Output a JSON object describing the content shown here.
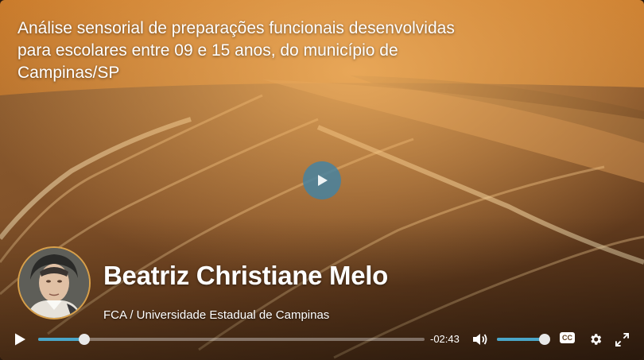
{
  "video": {
    "title": "Análise sensorial de preparações funcionais desenvolvidas para escolares entre 09 e 15 anos, do município de Campinas/SP",
    "presenter_name": "Beatriz Christiane Melo",
    "affiliation": "FCA / Universidade Estadual de Campinas",
    "time_remaining": "-02:43",
    "playback_progress": 0.12,
    "volume_level": 1.0,
    "cc_label": "CC"
  },
  "icons": {
    "center_play": "play-icon",
    "play": "play-icon",
    "volume": "volume-icon",
    "cc": "closed-captions-icon",
    "settings": "gear-icon",
    "fullscreen": "fullscreen-icon"
  },
  "colors": {
    "accent": "#4aa6c8",
    "play_button": "#4682a0",
    "avatar_border": "#d8a04a"
  }
}
